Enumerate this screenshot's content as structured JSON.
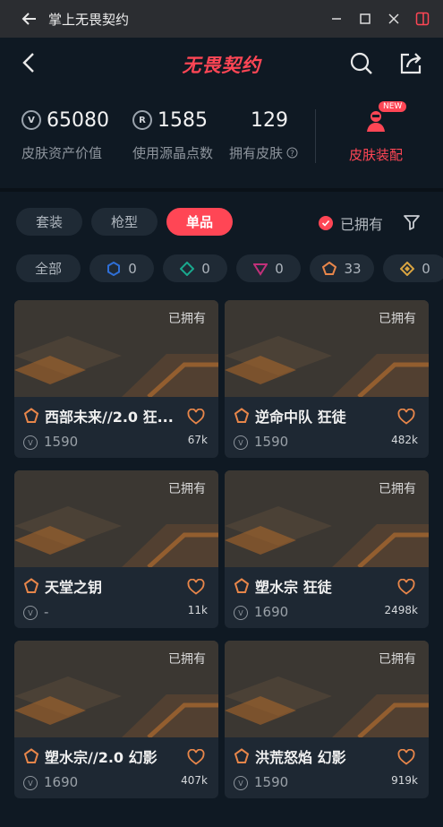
{
  "window": {
    "title": "掌上无畏契约"
  },
  "header": {
    "logo_text": "无畏契约"
  },
  "stats": {
    "asset_value": "65080",
    "asset_value_label": "皮肤资产价值",
    "radianite": "1585",
    "radianite_label": "使用源晶点数",
    "skins_owned": "129",
    "skins_owned_label": "拥有皮肤",
    "equip_label": "皮肤装配",
    "new_badge": "NEW"
  },
  "tabs": [
    {
      "label": "套装",
      "active": false
    },
    {
      "label": "枪型",
      "active": false
    },
    {
      "label": "单品",
      "active": true
    }
  ],
  "owned_filter_label": "已拥有",
  "tier_chips": [
    {
      "label": "全部",
      "color": ""
    },
    {
      "label": "0",
      "color": "#2f6fd6"
    },
    {
      "label": "0",
      "color": "#1aa88e"
    },
    {
      "label": "0",
      "color": "#c2307a"
    },
    {
      "label": "33",
      "color": "#e8864a"
    },
    {
      "label": "0",
      "color": "#d9a441"
    }
  ],
  "cards": [
    {
      "name": "西部未来//2.0 狂...",
      "price": "1590",
      "likes": "67k",
      "owned": "已拥有",
      "weapon": "rifle-wood"
    },
    {
      "name": "逆命中队 狂徒",
      "price": "1590",
      "likes": "482k",
      "owned": "已拥有",
      "weapon": "rifle-dark"
    },
    {
      "name": "天堂之钥",
      "price": "-",
      "likes": "11k",
      "owned": "已拥有",
      "weapon": "knife"
    },
    {
      "name": "塑水宗 狂徒",
      "price": "1690",
      "likes": "2498k",
      "owned": "已拥有",
      "weapon": "rifle-silver"
    },
    {
      "name": "塑水宗//2.0 幻影",
      "price": "1690",
      "likes": "407k",
      "owned": "已拥有",
      "weapon": "rifle-silver2"
    },
    {
      "name": "洪荒怒焰 幻影",
      "price": "1590",
      "likes": "919k",
      "owned": "已拥有",
      "weapon": "rifle-bone"
    }
  ],
  "colors": {
    "accent": "#ff4655",
    "tier_orange": "#e8864a"
  }
}
